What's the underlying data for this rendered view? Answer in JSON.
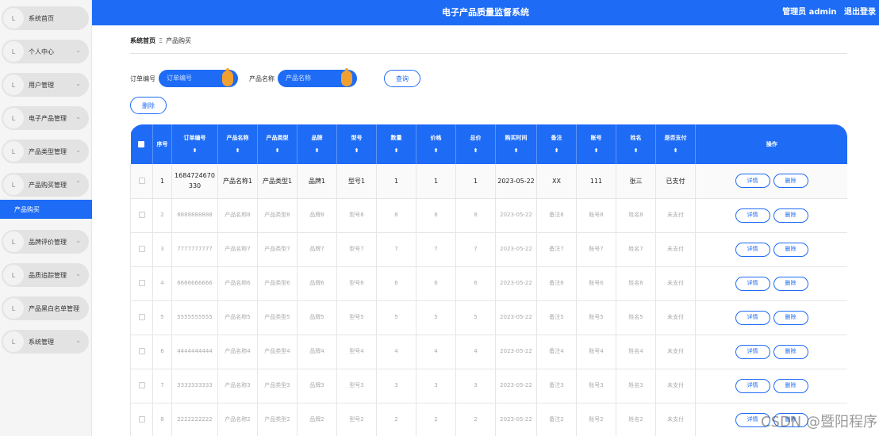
{
  "app": {
    "title": "电子产品质量监督系统",
    "user": "管理员 admin",
    "logout": "退出登录"
  },
  "sidebar": {
    "items": [
      {
        "label": "系统首页",
        "chevron": ""
      },
      {
        "label": "个人中心",
        "chevron": "⌄"
      },
      {
        "label": "用户管理",
        "chevron": "⌄"
      },
      {
        "label": "电子产品管理",
        "chevron": "⌄"
      },
      {
        "label": "产品类型管理",
        "chevron": "⌄"
      },
      {
        "label": "产品购买管理",
        "chevron": "⌃"
      },
      {
        "label": "品牌评价管理",
        "chevron": "⌄"
      },
      {
        "label": "品质追踪管理",
        "chevron": "⌄"
      },
      {
        "label": "产品黑白名单管理",
        "chevron": "⌄"
      },
      {
        "label": "系统管理",
        "chevron": "⌄"
      }
    ],
    "active_sub": "产品购买",
    "icon_glyph": "L"
  },
  "breadcrumb": {
    "home": "系统首页",
    "sep": "Ξ",
    "current": "产品购买"
  },
  "search": {
    "order_label": "订单编号",
    "order_placeholder": "订单编号",
    "product_label": "产品名称",
    "product_placeholder": "产品名称",
    "query_button": "查询"
  },
  "toolbar": {
    "delete_button": "删除"
  },
  "table": {
    "headers": [
      "序号",
      "订单编号",
      "产品名称",
      "产品类型",
      "品牌",
      "型号",
      "数量",
      "价格",
      "总价",
      "购买时间",
      "备注",
      "账号",
      "姓名",
      "是否支付",
      "操作"
    ],
    "sort_glyph": "⬍",
    "rows": [
      {
        "idx": "1",
        "order": "1684724670330",
        "name": "产品名称1",
        "type": "产品类型1",
        "brand": "品牌1",
        "model": "型号1",
        "qty": "1",
        "price": "1",
        "total": "1",
        "date": "2023-05-22",
        "note": "XX",
        "account": "111",
        "person": "张三",
        "paid": "已支付"
      },
      {
        "idx": "2",
        "order": "8888888888",
        "name": "产品名称8",
        "type": "产品类型8",
        "brand": "品牌8",
        "model": "型号8",
        "qty": "8",
        "price": "8",
        "total": "8",
        "date": "2023-05-22",
        "note": "备注8",
        "account": "账号8",
        "person": "姓名8",
        "paid": "未支付"
      },
      {
        "idx": "3",
        "order": "7777777777",
        "name": "产品名称7",
        "type": "产品类型7",
        "brand": "品牌7",
        "model": "型号7",
        "qty": "7",
        "price": "7",
        "total": "7",
        "date": "2023-05-22",
        "note": "备注7",
        "account": "账号7",
        "person": "姓名7",
        "paid": "未支付"
      },
      {
        "idx": "4",
        "order": "6666666666",
        "name": "产品名称6",
        "type": "产品类型6",
        "brand": "品牌6",
        "model": "型号6",
        "qty": "6",
        "price": "6",
        "total": "6",
        "date": "2023-05-22",
        "note": "备注6",
        "account": "账号6",
        "person": "姓名6",
        "paid": "未支付"
      },
      {
        "idx": "5",
        "order": "5555555555",
        "name": "产品名称5",
        "type": "产品类型5",
        "brand": "品牌5",
        "model": "型号5",
        "qty": "5",
        "price": "5",
        "total": "5",
        "date": "2023-05-22",
        "note": "备注5",
        "account": "账号5",
        "person": "姓名5",
        "paid": "未支付"
      },
      {
        "idx": "6",
        "order": "4444444444",
        "name": "产品名称4",
        "type": "产品类型4",
        "brand": "品牌4",
        "model": "型号4",
        "qty": "4",
        "price": "4",
        "total": "4",
        "date": "2023-05-22",
        "note": "备注4",
        "account": "账号4",
        "person": "姓名4",
        "paid": "未支付"
      },
      {
        "idx": "7",
        "order": "3333333333",
        "name": "产品名称3",
        "type": "产品类型3",
        "brand": "品牌3",
        "model": "型号3",
        "qty": "3",
        "price": "3",
        "total": "3",
        "date": "2023-05-22",
        "note": "备注3",
        "account": "账号3",
        "person": "姓名3",
        "paid": "未支付"
      },
      {
        "idx": "8",
        "order": "2222222222",
        "name": "产品名称2",
        "type": "产品类型2",
        "brand": "品牌2",
        "model": "型号2",
        "qty": "2",
        "price": "2",
        "total": "2",
        "date": "2023-05-22",
        "note": "备注2",
        "account": "账号2",
        "person": "姓名2",
        "paid": "未支付"
      }
    ],
    "detail_button": "详情",
    "row_delete_button": "删除"
  },
  "watermark": "CSDN @暨阳程序"
}
